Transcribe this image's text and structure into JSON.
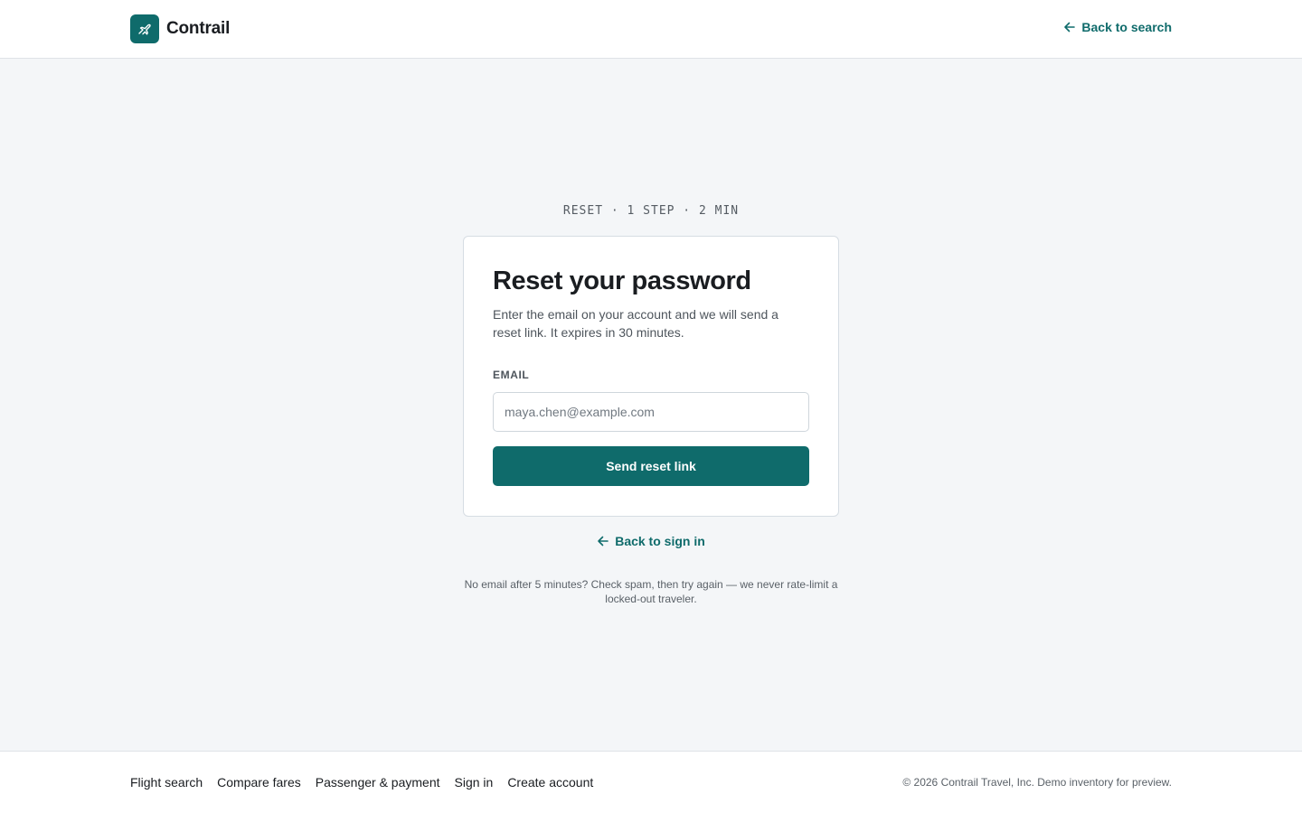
{
  "header": {
    "brand_name": "Contrail",
    "back_link": "Back to search"
  },
  "eyebrow": "RESET · 1 STEP · 2 MIN",
  "card": {
    "title": "Reset your password",
    "description": "Enter the email on your account and we will send a reset link. It expires in 30 minutes.",
    "email_label": "EMAIL",
    "email_placeholder": "maya.chen@example.com",
    "email_value": "",
    "submit_label": "Send reset link"
  },
  "back_signin": "Back to sign in",
  "help_note": "No email after 5 minutes? Check spam, then try again — we never rate-limit a locked-out traveler.",
  "footer": {
    "links": [
      "Flight search",
      "Compare fares",
      "Passenger & payment",
      "Sign in",
      "Create account"
    ],
    "copyright": "© 2026 Contrail Travel, Inc. Demo inventory for preview."
  },
  "icons": {
    "brand": "plane-icon",
    "back": "arrow-left-icon"
  },
  "colors": {
    "accent": "#0f6b6b",
    "page_bg": "#f4f6f8"
  }
}
